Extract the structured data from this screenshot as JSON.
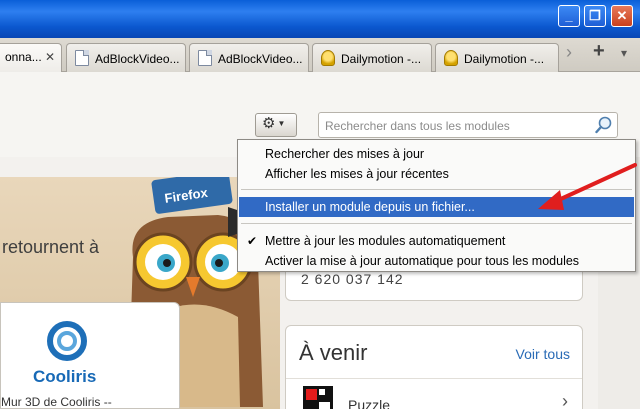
{
  "window": {
    "minimize_glyph": "_",
    "restore_glyph": "❐",
    "close_glyph": "✕"
  },
  "tabs": [
    {
      "label": "onna...",
      "icon": "none",
      "active": true
    },
    {
      "label": "AdBlockVideo...",
      "icon": "document-icon",
      "active": false
    },
    {
      "label": "AdBlockVideo...",
      "icon": "document-icon",
      "active": false
    },
    {
      "label": "Dailymotion -...",
      "icon": "dailymotion-icon",
      "active": false
    },
    {
      "label": "Dailymotion -...",
      "icon": "dailymotion-icon",
      "active": false
    }
  ],
  "tabstrip": {
    "close_glyph": "✕",
    "scroll_glyph": "›",
    "new_tab_glyph": "+",
    "list_glyph": "▾"
  },
  "toolbar": {
    "gear_glyph": "⚙",
    "search_placeholder": "Rechercher dans tous les modules"
  },
  "menu": {
    "items": [
      {
        "label": "Rechercher des mises à jour",
        "checked": false,
        "highlighted": false
      },
      {
        "label": "Afficher les mises à jour récentes",
        "checked": false,
        "highlighted": false
      },
      {
        "label": "Installer un module depuis un fichier...",
        "checked": false,
        "highlighted": true
      },
      {
        "label": "Mettre à jour les modules automatiquement",
        "checked": true,
        "highlighted": false
      },
      {
        "label": "Activer la mise à jour automatique pour tous les modules",
        "checked": false,
        "highlighted": false
      }
    ]
  },
  "featured": {
    "partial_text": "retournent à",
    "badge_text": "Firefox"
  },
  "cooliris": {
    "name": "Cooliris",
    "description": "Mur 3D de Cooliris --"
  },
  "stats": {
    "count": "2 620 037 142"
  },
  "upcoming": {
    "title": "À venir",
    "see_all": "Voir tous",
    "item_label": "Puzzle",
    "chevron": "›"
  },
  "colors": {
    "highlight": "#316ac5",
    "link": "#2a6bb6",
    "arrow": "#e01e1e"
  }
}
